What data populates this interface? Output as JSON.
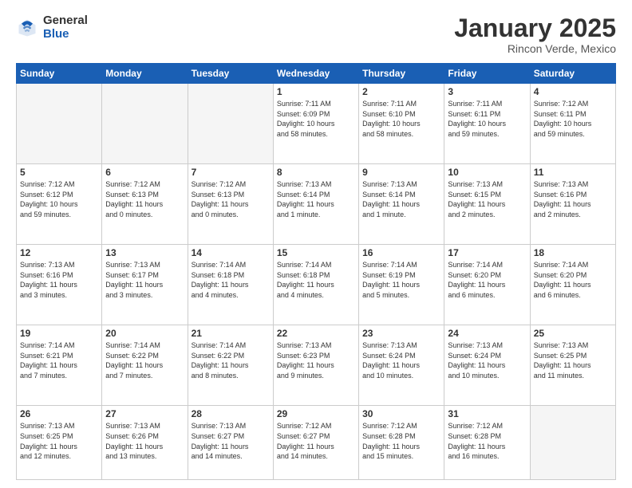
{
  "header": {
    "logo_general": "General",
    "logo_blue": "Blue",
    "month_title": "January 2025",
    "location": "Rincon Verde, Mexico"
  },
  "weekdays": [
    "Sunday",
    "Monday",
    "Tuesday",
    "Wednesday",
    "Thursday",
    "Friday",
    "Saturday"
  ],
  "weeks": [
    [
      {
        "day": "",
        "info": ""
      },
      {
        "day": "",
        "info": ""
      },
      {
        "day": "",
        "info": ""
      },
      {
        "day": "1",
        "info": "Sunrise: 7:11 AM\nSunset: 6:09 PM\nDaylight: 10 hours\nand 58 minutes."
      },
      {
        "day": "2",
        "info": "Sunrise: 7:11 AM\nSunset: 6:10 PM\nDaylight: 10 hours\nand 58 minutes."
      },
      {
        "day": "3",
        "info": "Sunrise: 7:11 AM\nSunset: 6:11 PM\nDaylight: 10 hours\nand 59 minutes."
      },
      {
        "day": "4",
        "info": "Sunrise: 7:12 AM\nSunset: 6:11 PM\nDaylight: 10 hours\nand 59 minutes."
      }
    ],
    [
      {
        "day": "5",
        "info": "Sunrise: 7:12 AM\nSunset: 6:12 PM\nDaylight: 10 hours\nand 59 minutes."
      },
      {
        "day": "6",
        "info": "Sunrise: 7:12 AM\nSunset: 6:13 PM\nDaylight: 11 hours\nand 0 minutes."
      },
      {
        "day": "7",
        "info": "Sunrise: 7:12 AM\nSunset: 6:13 PM\nDaylight: 11 hours\nand 0 minutes."
      },
      {
        "day": "8",
        "info": "Sunrise: 7:13 AM\nSunset: 6:14 PM\nDaylight: 11 hours\nand 1 minute."
      },
      {
        "day": "9",
        "info": "Sunrise: 7:13 AM\nSunset: 6:14 PM\nDaylight: 11 hours\nand 1 minute."
      },
      {
        "day": "10",
        "info": "Sunrise: 7:13 AM\nSunset: 6:15 PM\nDaylight: 11 hours\nand 2 minutes."
      },
      {
        "day": "11",
        "info": "Sunrise: 7:13 AM\nSunset: 6:16 PM\nDaylight: 11 hours\nand 2 minutes."
      }
    ],
    [
      {
        "day": "12",
        "info": "Sunrise: 7:13 AM\nSunset: 6:16 PM\nDaylight: 11 hours\nand 3 minutes."
      },
      {
        "day": "13",
        "info": "Sunrise: 7:13 AM\nSunset: 6:17 PM\nDaylight: 11 hours\nand 3 minutes."
      },
      {
        "day": "14",
        "info": "Sunrise: 7:14 AM\nSunset: 6:18 PM\nDaylight: 11 hours\nand 4 minutes."
      },
      {
        "day": "15",
        "info": "Sunrise: 7:14 AM\nSunset: 6:18 PM\nDaylight: 11 hours\nand 4 minutes."
      },
      {
        "day": "16",
        "info": "Sunrise: 7:14 AM\nSunset: 6:19 PM\nDaylight: 11 hours\nand 5 minutes."
      },
      {
        "day": "17",
        "info": "Sunrise: 7:14 AM\nSunset: 6:20 PM\nDaylight: 11 hours\nand 6 minutes."
      },
      {
        "day": "18",
        "info": "Sunrise: 7:14 AM\nSunset: 6:20 PM\nDaylight: 11 hours\nand 6 minutes."
      }
    ],
    [
      {
        "day": "19",
        "info": "Sunrise: 7:14 AM\nSunset: 6:21 PM\nDaylight: 11 hours\nand 7 minutes."
      },
      {
        "day": "20",
        "info": "Sunrise: 7:14 AM\nSunset: 6:22 PM\nDaylight: 11 hours\nand 7 minutes."
      },
      {
        "day": "21",
        "info": "Sunrise: 7:14 AM\nSunset: 6:22 PM\nDaylight: 11 hours\nand 8 minutes."
      },
      {
        "day": "22",
        "info": "Sunrise: 7:13 AM\nSunset: 6:23 PM\nDaylight: 11 hours\nand 9 minutes."
      },
      {
        "day": "23",
        "info": "Sunrise: 7:13 AM\nSunset: 6:24 PM\nDaylight: 11 hours\nand 10 minutes."
      },
      {
        "day": "24",
        "info": "Sunrise: 7:13 AM\nSunset: 6:24 PM\nDaylight: 11 hours\nand 10 minutes."
      },
      {
        "day": "25",
        "info": "Sunrise: 7:13 AM\nSunset: 6:25 PM\nDaylight: 11 hours\nand 11 minutes."
      }
    ],
    [
      {
        "day": "26",
        "info": "Sunrise: 7:13 AM\nSunset: 6:25 PM\nDaylight: 11 hours\nand 12 minutes."
      },
      {
        "day": "27",
        "info": "Sunrise: 7:13 AM\nSunset: 6:26 PM\nDaylight: 11 hours\nand 13 minutes."
      },
      {
        "day": "28",
        "info": "Sunrise: 7:13 AM\nSunset: 6:27 PM\nDaylight: 11 hours\nand 14 minutes."
      },
      {
        "day": "29",
        "info": "Sunrise: 7:12 AM\nSunset: 6:27 PM\nDaylight: 11 hours\nand 14 minutes."
      },
      {
        "day": "30",
        "info": "Sunrise: 7:12 AM\nSunset: 6:28 PM\nDaylight: 11 hours\nand 15 minutes."
      },
      {
        "day": "31",
        "info": "Sunrise: 7:12 AM\nSunset: 6:28 PM\nDaylight: 11 hours\nand 16 minutes."
      },
      {
        "day": "",
        "info": ""
      }
    ]
  ]
}
